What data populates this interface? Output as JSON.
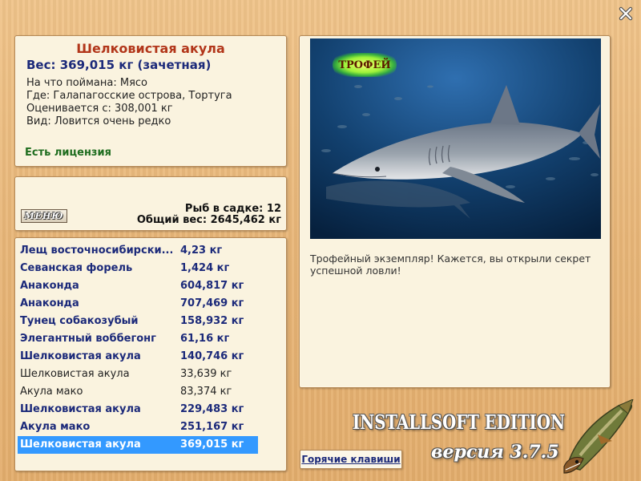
{
  "close": {
    "label": "X"
  },
  "fish_info": {
    "name": "Шелковистая акула",
    "weight": "Вес: 369,015 кг (зачетная)",
    "bait": "На что поймана: Мясо",
    "location": "Где: Галапагосские острова, Тортуга",
    "valued_from": "Оценивается с: 308,001 кг",
    "rarity": "Вид: Ловится очень редко",
    "license": "Есть лицензия"
  },
  "cage": {
    "menu_label": "МЕНЮ",
    "count": "Рыб в садке: 12",
    "total": "Общий вес: 2645,462 кг"
  },
  "catch_list": [
    {
      "name": "Лещ восточносибирски...",
      "weight": "4,23 кг",
      "style": "bold"
    },
    {
      "name": "Севанская форель",
      "weight": "1,424 кг",
      "style": "bold"
    },
    {
      "name": "Анаконда",
      "weight": "604,817 кг",
      "style": "bold"
    },
    {
      "name": "Анаконда",
      "weight": "707,469 кг",
      "style": "bold"
    },
    {
      "name": "Тунец собакозубый",
      "weight": "158,932 кг",
      "style": "bold"
    },
    {
      "name": "Элегантный воббегонг",
      "weight": "61,16 кг",
      "style": "bold"
    },
    {
      "name": "Шелковистая акула",
      "weight": "140,746 кг",
      "style": "bold"
    },
    {
      "name": "Шелковистая акула",
      "weight": "33,639 кг",
      "style": "normal"
    },
    {
      "name": "Акула мако",
      "weight": "83,374 кг",
      "style": "normal"
    },
    {
      "name": "Шелковистая акула",
      "weight": "229,483 кг",
      "style": "bold"
    },
    {
      "name": "Акула мако",
      "weight": "251,167 кг",
      "style": "bold"
    },
    {
      "name": "Шелковистая акула",
      "weight": "369,015 кг",
      "style": "selected"
    }
  ],
  "photo": {
    "trophy_badge": "ТРОФЕЙ",
    "message": "Трофейный экземпляр! Кажется, вы открыли секрет успешной ловли!"
  },
  "hotkeys_label": "Горячие клавиши",
  "branding": {
    "edition": "INSTALLSOFT EDITION",
    "version": "версия 3.7.5"
  },
  "colors": {
    "highlight": "#3399ff",
    "title_red": "#b2361a",
    "name_blue": "#1c2a7a",
    "license_green": "#1f6d1f"
  },
  "icons": {
    "close": "close-icon",
    "logo": "pike-fish-icon"
  }
}
